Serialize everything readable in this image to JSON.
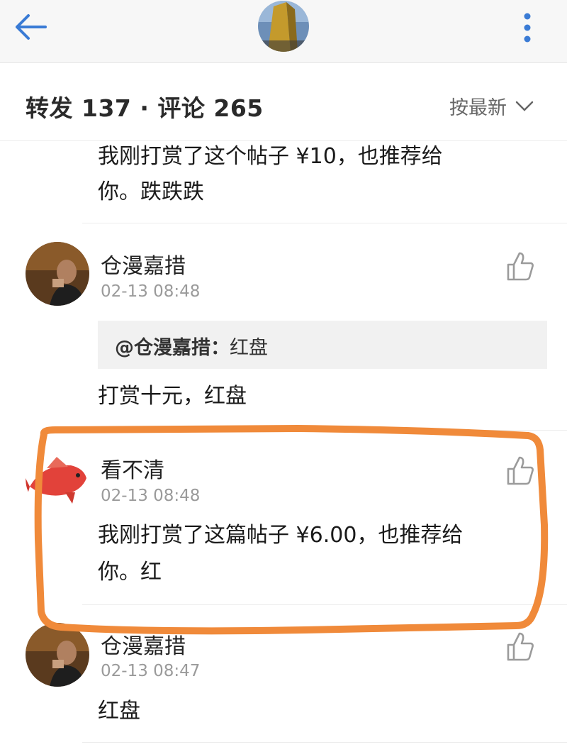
{
  "colors": {
    "accent_blue": "#3a7bd5",
    "highlight_orange": "#f08a3a",
    "quote_bg": "#f1f1f1",
    "time_gray": "#9a9a9a"
  },
  "topbar": {
    "back_icon": "arrow-left-icon",
    "more_icon": "vertical-dots-icon"
  },
  "header": {
    "counts_text": "转发 137 · 评论 265",
    "sort_label": "按最新"
  },
  "comments": [
    {
      "text_line1": "我刚打赏了这个帖子 ¥10，也推荐给",
      "text_line2": "你。跌跌跌"
    },
    {
      "name": "仓漫嘉措",
      "time": "02-13 08:48",
      "quote_name": "@仓漫嘉措：",
      "quote_text": "红盘",
      "text": "打赏十元，红盘"
    },
    {
      "name": "看不清",
      "time": "02-13 08:48",
      "text_line1": "我刚打赏了这篇帖子 ¥6.00，也推荐给",
      "text_line2": "你。红"
    },
    {
      "name": "仓漫嘉措",
      "time": "02-13 08:47",
      "text": "红盘"
    }
  ]
}
